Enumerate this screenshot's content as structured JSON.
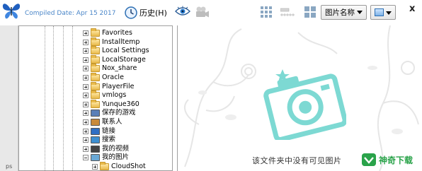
{
  "toolbar": {
    "compiled_label": "Compiled Date: Apr 15 2017",
    "history_label": "历史(H)",
    "sort_label": "图片名称",
    "close_glyph": "x"
  },
  "icons": {
    "app": "butterfly-icon",
    "history": "clock-icon",
    "eye": "eye-icon",
    "camera": "video-camera-icon",
    "grid_large": "grid-large-icon",
    "grid_small": "grid-small-icon",
    "size_slider": "size-slider-icon",
    "view_mode": "picture-icon"
  },
  "colors": {
    "compiled_text": "#4a86c8",
    "camera_teal": "#7dd9d3",
    "watermark_green": "#2aa34a"
  },
  "tree": {
    "items": [
      {
        "label": "Favorites",
        "expander": "plus",
        "icon": "folder-icon"
      },
      {
        "label": "Installtemp",
        "expander": "plus",
        "icon": "folder-icon"
      },
      {
        "label": "Local Settings",
        "expander": "plus",
        "icon": "folder-icon"
      },
      {
        "label": "LocalStorage",
        "expander": "plus",
        "icon": "folder-icon"
      },
      {
        "label": "Nox_share",
        "expander": "plus",
        "icon": "folder-icon"
      },
      {
        "label": "Oracle",
        "expander": "plus",
        "icon": "folder-icon"
      },
      {
        "label": "PlayerFile",
        "expander": "plus",
        "icon": "folder-icon"
      },
      {
        "label": "vmlogs",
        "expander": "plus",
        "icon": "folder-icon"
      },
      {
        "label": "Yunque360",
        "expander": "plus",
        "icon": "folder-icon"
      },
      {
        "label": "保存的游戏",
        "expander": "plus",
        "icon": "saved-games-icon"
      },
      {
        "label": "联系人",
        "expander": "plus",
        "icon": "contacts-icon"
      },
      {
        "label": "链接",
        "expander": "plus",
        "icon": "links-icon"
      },
      {
        "label": "搜索",
        "expander": "plus",
        "icon": "search-icon"
      },
      {
        "label": "我的视频",
        "expander": "plus",
        "icon": "videos-icon"
      },
      {
        "label": "我的图片",
        "expander": "minus",
        "icon": "pictures-icon"
      },
      {
        "label": "CloudShot",
        "expander": "plus",
        "icon": "folder-icon",
        "indent": true
      }
    ]
  },
  "preview": {
    "empty_message": "该文件夹中没有可见图片"
  },
  "watermark": {
    "text": "神奇下载"
  },
  "leftstrip": {
    "text": "ps"
  }
}
